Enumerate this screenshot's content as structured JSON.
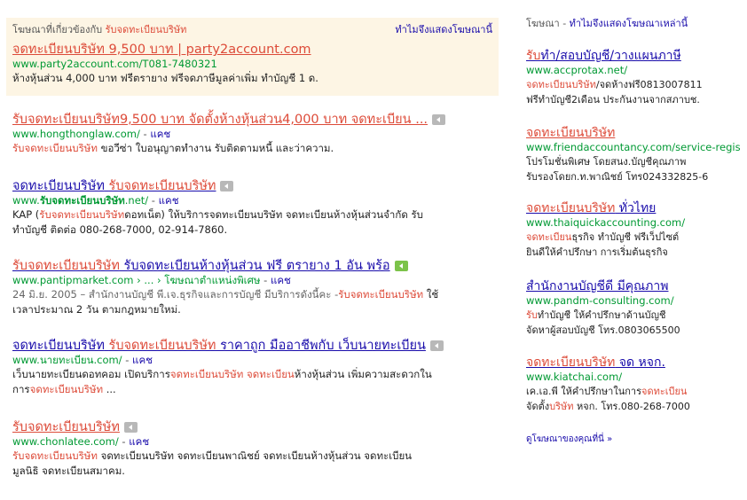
{
  "top_ads": {
    "label_prefix": "โฆษณาที่เกี่ยวข้องกับ ",
    "label_query": "รับจดทะเบียนบริษัท",
    "why_link": "ทำไมจึงแสดงโฆษณานี้",
    "ad": {
      "title": "จดทะเบียนบริษัท 9,500 บาท | party2account.com",
      "url": "www.party2account.com/T081-7480321",
      "snippet": "ห้างหุ้นส่วน 4,000 บาท ฟรีตรายาง ฟรีจดภาษีมูลค่าเพิ่ม ทำบัญชี 1 ด."
    }
  },
  "results": [
    {
      "title_parts": [
        "รับจดทะเบียนบริษัท",
        "9,500 บาท จัดตั้งห้างหุ้นส่วน4,000 บาท จดทะเบียน ..."
      ],
      "url": "www.hongthonglaw.com/",
      "cache": "แคช",
      "snippet_parts": [
        "รับจดทะเบียนบริษัท",
        " ขอวีซ่า ใบอนุญาตทำงาน รับติดตามหนี้ และว่าความ."
      ]
    },
    {
      "title_parts": [
        "จดทะเบียนบริษัท",
        " ",
        "รับจดทะเบียนบริษัท"
      ],
      "url_parts": [
        "www.",
        "รับจดทะเบียนบริษัท",
        ".net/"
      ],
      "cache": "แคช",
      "snippet_line1_parts": [
        "KAP (",
        "รับจดทะเบียนบริษัท",
        "ดอทเน็ต) ให้บริการจดทะเบียนบริษัท จดทะเบียนห้างหุ้นส่วนจำกัด รับ"
      ],
      "snippet_line2": "ทำบัญชี ติดต่อ 080-268-7000, 02-914-7860."
    },
    {
      "title_parts": [
        "รับจดทะเบียนบริษัท",
        " รับจดทะเบียนห้างหุ้นส่วน ฟรี ตรายาง 1 อัน พร้อ"
      ],
      "url": "www.pantipmarket.com › ... › โฆษณาตำแหน่งพิเศษ",
      "cache": "แคช",
      "snippet_line1_parts": [
        "24 มิ.ย. 2005 – สำนักงานบัญชี พี.เจ.ธุรกิจและการบัญชี มีบริการดังนี้คะ -",
        "รับจดทะเบียนบริษัท",
        " ใช้"
      ],
      "snippet_line2": "เวลาประมาณ 2 วัน ตามกฎหมายใหม่."
    },
    {
      "title_parts": [
        "จดทะเบียนบริษัท",
        " ",
        "รับจดทะเบียนบริษัท",
        " ราคาถูก มืออาชีพกับ เว็บนายทะเบียน"
      ],
      "url": "www.นายทะเบียน.com/",
      "cache": "แคช",
      "snippet_line1_parts": [
        "เว็บนายทะเบียนดอทคอม เปิดบริการ",
        "จดทะเบียนบริษัท",
        " ",
        "จดทะเบียน",
        "ห้างหุ้นส่วน เพิ่มความสะดวกใน"
      ],
      "snippet_line2_parts": [
        "การ",
        "จดทะเบียนบริษัท",
        " ..."
      ]
    },
    {
      "title": "รับจดทะเบียนบริษัท",
      "url": "www.chonlatee.com/",
      "cache": "แคช",
      "snippet_line1_parts": [
        "รับจดทะเบียนบริษัท",
        " จดทะเบียนบริษัท จดทะเบียนพาณิชย์ จดทะเบียนห้างหุ้นส่วน จดทะเบียน"
      ],
      "snippet_line2": "มูลนิธิ จดทะเบียนสมาคม."
    }
  ],
  "right_ads": {
    "label": "โฆษณา - ",
    "why_link": "ทำไมจึงแสดงโฆษณาเหล่านี้",
    "items": [
      {
        "title_parts": [
          "รับ",
          "ทำ/สอบบัญชี/วางแผนภาษี"
        ],
        "url": "www.accprotax.net/",
        "line1_parts": [
          "จดทะเบียนบริษัท",
          "/จดห้างฟรี0813007811"
        ],
        "line2": "ฟรีทำบัญชี2เดือน ประกันงานจากสภาบช."
      },
      {
        "title": "จดทะเบียนบริษัท",
        "url": "www.friendaccountancy.com/service-regis",
        "line1": "โปรโมชั่นพิเศษ โดยสนง.บัญชีคุณภาพ",
        "line2": "รับรองโดยก.ท.พาณิชย์ โทร024332825-6"
      },
      {
        "title_parts": [
          "จดทะเบียนบริษัท",
          " ทั่วไทย"
        ],
        "url": "www.thaiquickaccounting.com/",
        "line1_parts": [
          "จดทะเบียน",
          "ธุรกิจ ทำบัญชี ฟรีเว็ปไซต์"
        ],
        "line2": "ยินดีให้คำปรึกษา การเริ่มต้นธุรกิจ"
      },
      {
        "title": "สำนักงานบัญชีดี มีคุณภาพ",
        "url": "www.pandm-consulting.com/",
        "line1_parts": [
          "รับ",
          "ทำบัญชี ให้คำปรึกษาด้านบัญชี"
        ],
        "line2": "จัดหาผู้สอบบัญชี โทร.0803065500"
      },
      {
        "title_parts": [
          "จดทะเบียนบริษัท",
          " จด หจก."
        ],
        "url": "www.kiatchai.com/",
        "line1_parts": [
          "เค.เอ.พี ให้คำปรึกษาในการ",
          "จดทะเบียน"
        ],
        "line2_parts": [
          "จัดตั้ง",
          "บริษัท",
          " หจก. โทร.080-268-7000"
        ]
      }
    ],
    "more_link": "ดูโฆษณาของคุณที่นี่ »"
  },
  "colors": {
    "title_blue": "#1a0dab",
    "highlight_red": "#dd4b39",
    "url_green": "#009933",
    "ad_background": "#fdf5e4"
  }
}
